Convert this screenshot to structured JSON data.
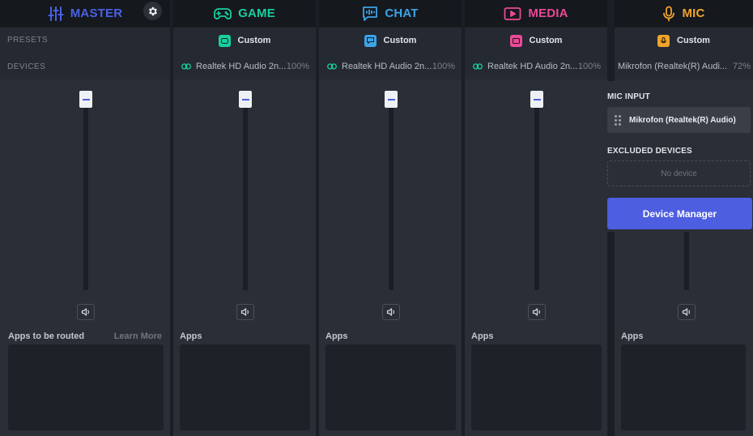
{
  "colors": {
    "master": "#4a62e3",
    "game": "#17cfa0",
    "chat": "#3ea3e8",
    "media": "#e84a97",
    "mic": "#f0a32b",
    "accent_button": "#4d5ee0"
  },
  "sidebar": {
    "presets_label": "PRESETS",
    "devices_label": "DEVICES"
  },
  "master": {
    "title": "MASTER",
    "icon": "sliders-icon",
    "apps_label": "Apps to be routed",
    "learn_more": "Learn More"
  },
  "channels": [
    {
      "key": "game",
      "title": "GAME",
      "icon": "gamepad-icon",
      "preset": "Custom",
      "device": "Realtek HD Audio 2n...",
      "volume": "100%",
      "apps_label": "Apps"
    },
    {
      "key": "chat",
      "title": "CHAT",
      "icon": "chat-icon",
      "preset": "Custom",
      "device": "Realtek HD Audio 2n...",
      "volume": "100%",
      "apps_label": "Apps"
    },
    {
      "key": "media",
      "title": "MEDIA",
      "icon": "play-icon",
      "preset": "Custom",
      "device": "Realtek HD Audio 2n...",
      "volume": "100%",
      "apps_label": "Apps"
    },
    {
      "key": "mic",
      "title": "MIC",
      "icon": "microphone-icon",
      "preset": "Custom",
      "device": "Mikrofon (Realtek(R) Audi...",
      "volume": "72%",
      "apps_label": "Apps"
    }
  ],
  "mic_popup": {
    "mic_input_label": "MIC INPUT",
    "mic_input_device": "Mikrofon (Realtek(R) Audio)",
    "excluded_label": "EXCLUDED DEVICES",
    "no_device": "No device",
    "device_manager": "Device Manager"
  }
}
